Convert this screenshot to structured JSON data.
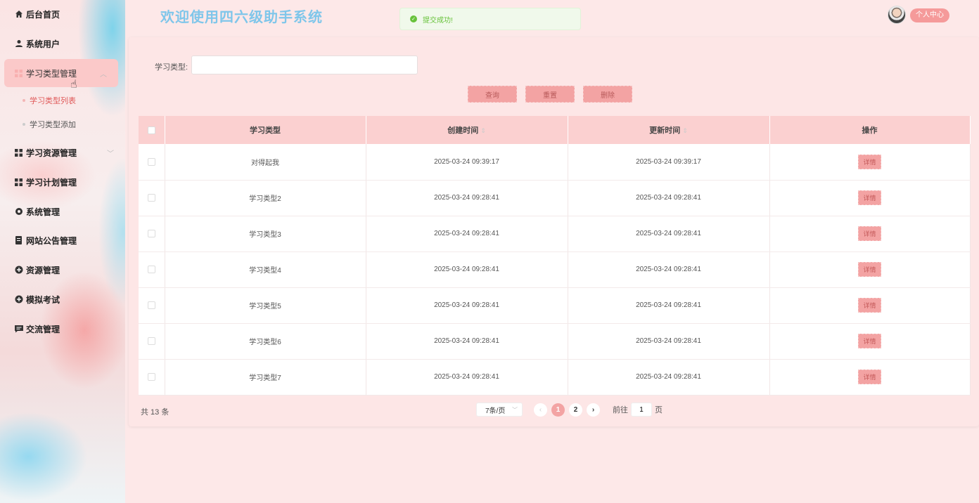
{
  "sidebar": {
    "items": [
      {
        "label": "后台首页",
        "icon": "home-icon"
      },
      {
        "label": "系统用户",
        "icon": "user-icon"
      },
      {
        "label": "学习类型管理",
        "icon": "grid-icon"
      },
      {
        "label": "学习资源管理",
        "icon": "grid-icon"
      },
      {
        "label": "学习计划管理",
        "icon": "grid-icon"
      },
      {
        "label": "系统管理",
        "icon": "gear-icon"
      },
      {
        "label": "网站公告管理",
        "icon": "document-icon"
      },
      {
        "label": "资源管理",
        "icon": "plus-circle-icon"
      },
      {
        "label": "模拟考试",
        "icon": "plus-circle-icon"
      },
      {
        "label": "交流管理",
        "icon": "chat-icon"
      }
    ],
    "subitems": [
      {
        "label": "学习类型列表"
      },
      {
        "label": "学习类型添加"
      }
    ]
  },
  "header": {
    "title": "欢迎使用四六级助手系统",
    "toast": "提交成功!",
    "user_center": "个人中心"
  },
  "search": {
    "label": "学习类型:",
    "value": "",
    "placeholder": ""
  },
  "buttons": {
    "query": "查询",
    "reset": "重置",
    "delete": "删除"
  },
  "table": {
    "headers": [
      "学习类型",
      "创建时间",
      "更新时间",
      "操作"
    ],
    "detail_label": "详情",
    "rows": [
      {
        "type": "对得起我",
        "created": "2025-03-24 09:39:17",
        "updated": "2025-03-24 09:39:17"
      },
      {
        "type": "学习类型2",
        "created": "2025-03-24 09:28:41",
        "updated": "2025-03-24 09:28:41"
      },
      {
        "type": "学习类型3",
        "created": "2025-03-24 09:28:41",
        "updated": "2025-03-24 09:28:41"
      },
      {
        "type": "学习类型4",
        "created": "2025-03-24 09:28:41",
        "updated": "2025-03-24 09:28:41"
      },
      {
        "type": "学习类型5",
        "created": "2025-03-24 09:28:41",
        "updated": "2025-03-24 09:28:41"
      },
      {
        "type": "学习类型6",
        "created": "2025-03-24 09:28:41",
        "updated": "2025-03-24 09:28:41"
      },
      {
        "type": "学习类型7",
        "created": "2025-03-24 09:28:41",
        "updated": "2025-03-24 09:28:41"
      }
    ]
  },
  "pagination": {
    "total": "共 13 条",
    "page_size": "7条/页",
    "pages": [
      "1",
      "2"
    ],
    "goto_prefix": "前往",
    "goto_value": "1",
    "goto_suffix": "页"
  },
  "colors": {
    "accent": "#f3a3a3",
    "title": "#7fc6ea",
    "success": "#67c23a"
  }
}
